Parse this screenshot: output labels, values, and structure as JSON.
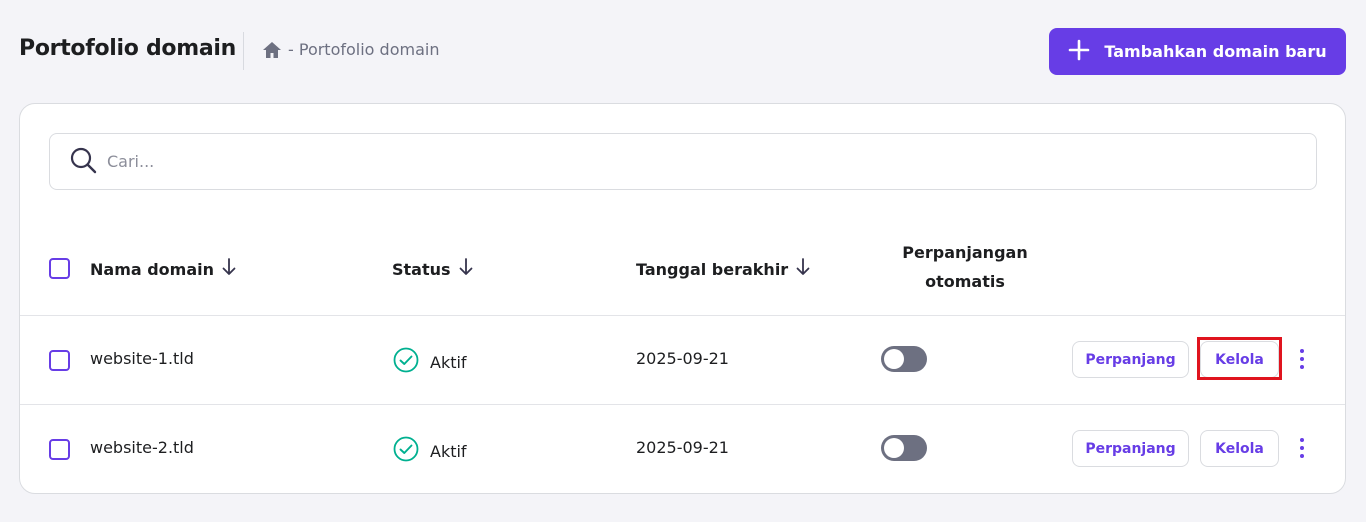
{
  "header": {
    "title": "Portofolio domain",
    "breadcrumb_text": "- Portofolio domain",
    "add_button_label": "Tambahkan domain baru"
  },
  "search": {
    "placeholder": "Cari..."
  },
  "table": {
    "columns": {
      "domain": "Nama domain",
      "status": "Status",
      "expiry": "Tanggal berakhir",
      "auto_renew_line1": "Perpanjangan",
      "auto_renew_line2": "otomatis"
    },
    "rows": [
      {
        "domain": "website-1.tld",
        "status": "Aktif",
        "expiry": "2025-09-21",
        "auto_renew": false,
        "renew_label": "Perpanjang",
        "manage_label": "Kelola",
        "manage_highlighted": true
      },
      {
        "domain": "website-2.tld",
        "status": "Aktif",
        "expiry": "2025-09-21",
        "auto_renew": false,
        "renew_label": "Perpanjang",
        "manage_label": "Kelola",
        "manage_highlighted": false
      }
    ]
  },
  "colors": {
    "accent": "#673de6",
    "success": "#00b090",
    "highlight": "#e0141e",
    "toggle_off": "#6d7081"
  },
  "icons": [
    "home-icon",
    "plus-icon",
    "search-icon",
    "sort-down-icon",
    "check-circle-icon",
    "kebab-menu-icon"
  ]
}
